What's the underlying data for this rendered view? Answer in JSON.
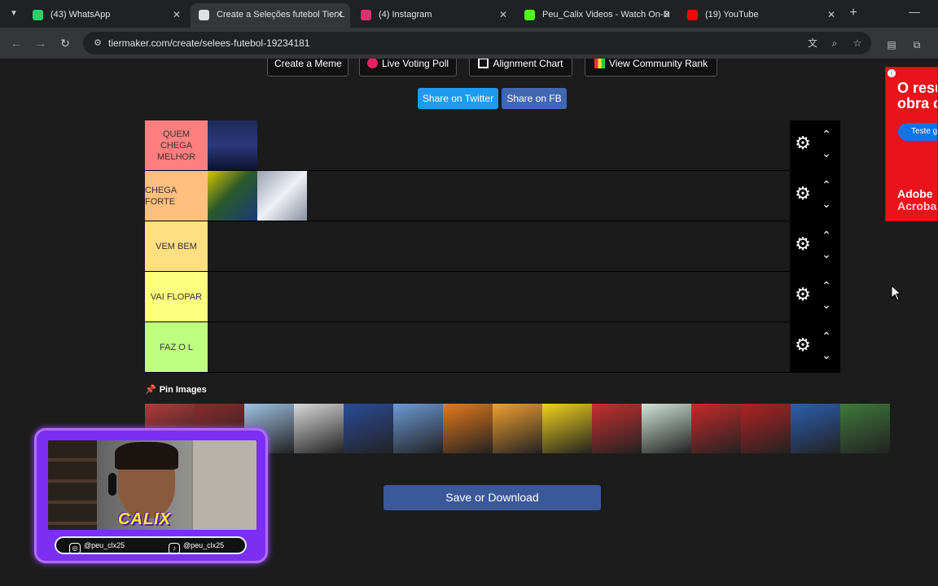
{
  "browser": {
    "tabs": [
      {
        "label": "(43) WhatsApp",
        "favicon_color": "#25d366",
        "favicon_text": "43",
        "active": false
      },
      {
        "label": "Create a Seleções futebol Tier L",
        "favicon_color": "#e0e0e0",
        "favicon_text": "",
        "active": true
      },
      {
        "label": "(4) Instagram",
        "favicon_color": "#e1306c",
        "favicon_text": "",
        "active": false
      },
      {
        "label": "Peu_Calix Videos - Watch On-D",
        "favicon_color": "#53fc18",
        "favicon_text": "K",
        "active": false
      },
      {
        "label": "(19) YouTube",
        "favicon_color": "#ff0000",
        "favicon_text": "▶",
        "active": false
      }
    ],
    "tab_close": "✕",
    "new_tab": "+",
    "minimize": "—",
    "url": "tiermaker.com/create/selees-futebol-19234181",
    "icons": [
      "back-arrow-icon",
      "forward-arrow-icon",
      "reload-icon",
      "site-info-icon",
      "translate-icon",
      "zoom-icon",
      "bookmark-star-icon",
      "extension-doc-icon",
      "extensions-puzzle-icon"
    ]
  },
  "toolbar": {
    "create_meme": "Create a Meme",
    "live_voting": "Live Voting Poll",
    "alignment_chart": "Alignment Chart",
    "community_rank": "View Community Rank"
  },
  "share": {
    "twitter": "Share on Twitter",
    "facebook": "Share on FB",
    "twitter_color": "#1d9bf0",
    "facebook_color": "#4267b2"
  },
  "tiers": [
    {
      "label": "QUEM CHEGA MELHOR",
      "color": "#ff7f7f",
      "images": [
        "#1d2a5a"
      ]
    },
    {
      "label": "CHEGA FORTE",
      "color": "#ffbf7f",
      "images": [
        "#2b5a2a",
        "#d8d8e0"
      ]
    },
    {
      "label": "VEM BEM",
      "color": "#ffdf7f",
      "images": []
    },
    {
      "label": "VAI FLOPAR",
      "color": "#ffff7f",
      "images": []
    },
    {
      "label": "FAZ O L",
      "color": "#bfff7f",
      "images": []
    }
  ],
  "pin_images": {
    "title": "Pin Images",
    "images": [
      "#b23a3a",
      "#8a2b2b",
      "#9fc3e4",
      "#d9d9d9",
      "#2b4c9a",
      "#6c9ad6",
      "#e67a1c",
      "#f0a030",
      "#f2d21b",
      "#c7302f",
      "#d0e4d8",
      "#c92a2a",
      "#b22222",
      "#2c5fb0",
      "#3f7a3a"
    ]
  },
  "save_button": "Save or Download",
  "ad": {
    "headline": "O resu obra c",
    "cta": "Teste g",
    "brand": "Adobe",
    "product": "Acroba"
  },
  "webcam": {
    "name": "CALIX",
    "instagram": "@peu_clx25",
    "tiktok": "@peu_clx25"
  }
}
